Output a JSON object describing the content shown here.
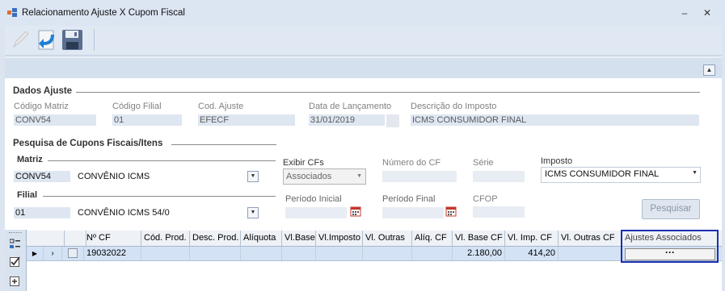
{
  "window": {
    "title": "Relacionamento Ajuste X Cupom Fiscal",
    "minimize_glyph": "‒",
    "close_glyph": "✕"
  },
  "toolbar": {
    "buttons": [
      "edit-icon",
      "return-icon",
      "save-icon"
    ]
  },
  "dados_ajuste": {
    "title": "Dados Ajuste",
    "codigo_matriz": {
      "label": "Código Matriz",
      "value": "CONV54"
    },
    "codigo_filial": {
      "label": "Código Filial",
      "value": "01"
    },
    "cod_ajuste": {
      "label": "Cod. Ajuste",
      "value": "EFECF"
    },
    "data_lancamento": {
      "label": "Data de Lançamento",
      "value": "31/01/2019"
    },
    "descricao_imposto": {
      "label": "Descrição do Imposto",
      "value": "ICMS CONSUMIDOR FINAL"
    }
  },
  "pesquisa": {
    "title": "Pesquisa de Cupons Fiscais/Itens",
    "matriz": {
      "title": "Matriz",
      "code": "CONV54",
      "name": "CONVÊNIO ICMS"
    },
    "filial": {
      "title": "Filial",
      "code": "01",
      "name": "CONVÊNIO ICMS 54/0"
    },
    "exibir_cfs": {
      "label": "Exibir CFs",
      "value": "Associados"
    },
    "numero_cf": {
      "label": "Número do CF"
    },
    "serie": {
      "label": "Série"
    },
    "imposto": {
      "label": "Imposto",
      "value": "ICMS CONSUMIDOR FINAL"
    },
    "periodo_inicial": {
      "label": "Período Inicial"
    },
    "periodo_final": {
      "label": "Período Final"
    },
    "cfop": {
      "label": "CFOP"
    },
    "pesquisar_button": "Pesquisar"
  },
  "grid": {
    "columns": [
      "Nº CF",
      "Cód. Prod.",
      "Desc. Prod.",
      "Alíquota",
      "Vl.Base",
      "Vl.Imposto",
      "Vl. Outras",
      "Alíq. CF",
      "Vl. Base CF",
      "Vl. Imp. CF",
      "Vl. Outras CF",
      "Ajustes Associados"
    ],
    "rows": [
      {
        "nro_cf": "19032022",
        "vl_base_cf": "2.180,00",
        "vl_imp_cf": "414,20",
        "ajustes_button": "···"
      }
    ]
  },
  "colors": {
    "accent": "#1a2fb4",
    "window_bg": "#dbe4ef",
    "row_selected": "#d3e2f5"
  }
}
